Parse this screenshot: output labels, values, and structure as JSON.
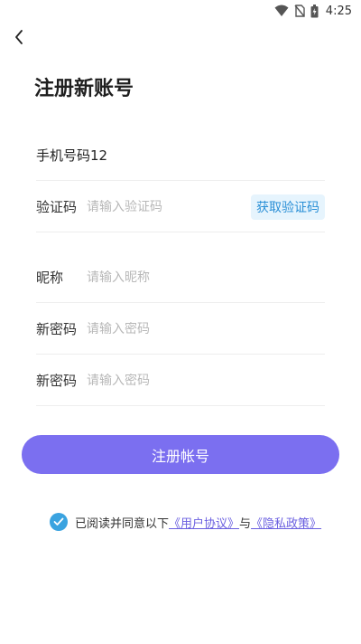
{
  "status_bar": {
    "time": "4:25"
  },
  "page": {
    "title": "注册新账号"
  },
  "form": {
    "phone": {
      "label": "手机号码12"
    },
    "code": {
      "label": "验证码",
      "placeholder": "请输入验证码",
      "button": "获取验证码"
    },
    "nickname": {
      "label": "昵称",
      "placeholder": "请输入昵称"
    },
    "password": {
      "label": "新密码",
      "placeholder": "请输入密码"
    },
    "confirm": {
      "label": "新密码",
      "placeholder": "请输入密码"
    }
  },
  "submit_label": "注册帐号",
  "agreement": {
    "checked": true,
    "prefix": "已阅读并同意以下",
    "user_agreement": "《用户协议》",
    "joiner": "与",
    "privacy": "《隐私政策》"
  },
  "colors": {
    "primary": "#7b6ff0",
    "check": "#3aa3e0",
    "link": "#6a5fe0",
    "code_bg": "#e6f4fd",
    "code_text": "#2a8fd6"
  },
  "icons": [
    "wifi-icon",
    "no-sim-icon",
    "battery-charging-icon",
    "back-arrow-icon",
    "checkmark-icon"
  ]
}
